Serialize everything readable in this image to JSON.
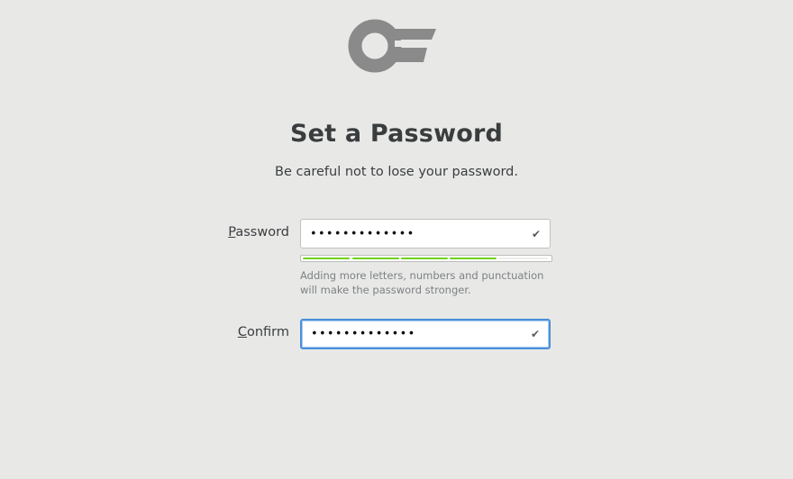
{
  "header": {
    "logo_icon": "key-icon",
    "title": "Set a Password",
    "subtitle": "Be careful not to lose your password."
  },
  "password": {
    "label_mnemonic": "P",
    "label_rest": "assword",
    "value": "•••••••••••••",
    "status_icon": "checkmark-icon",
    "strength_level": 0.8,
    "strength_segments_total": 5,
    "strength_segments_filled": 4,
    "hint": "Adding more letters, numbers and punctuation will make the password stronger."
  },
  "confirm": {
    "label_mnemonic": "C",
    "label_rest": "onfirm",
    "value": "•••••••••••••",
    "status_icon": "checkmark-icon"
  },
  "colors": {
    "background": "#e8e8e7",
    "strength_fill": "#73d216",
    "focus_border": "#4a90d9",
    "logo": "#8a8a8a"
  }
}
